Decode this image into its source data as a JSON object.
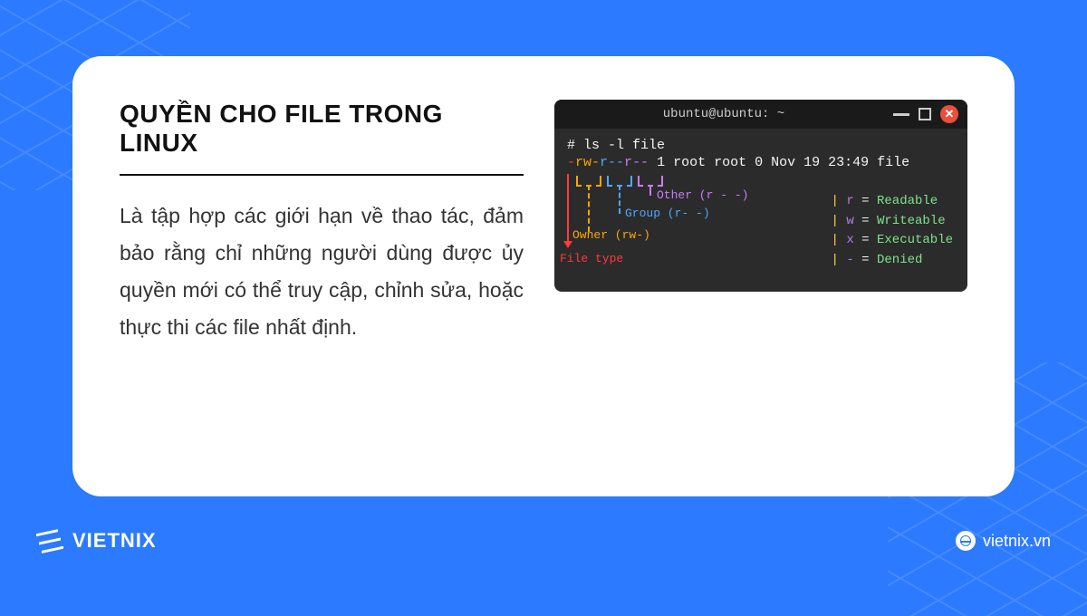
{
  "title": "QUYỀN CHO FILE TRONG LINUX",
  "description": "Là tập hợp các giới hạn về thao tác, đảm bảo rằng chỉ những người dùng được ủy quyền mới có thể truy cập, chỉnh sửa, hoặc thực thi các file nhất định.",
  "terminal": {
    "window_title": "ubuntu@ubuntu: ~",
    "command": "# ls -l file",
    "perm_filetype": "-",
    "perm_owner": "rw-",
    "perm_group": "r--",
    "perm_other": "r--",
    "rest": " 1 root root 0 Nov 19 23:49 file",
    "labels": {
      "other": "Other (r - -)",
      "group": "Group (r- -)",
      "owner": "Owner (rw-)",
      "filetype": "File type"
    },
    "legend": [
      {
        "key": "r",
        "val": "Readable"
      },
      {
        "key": "w",
        "val": "Writeable"
      },
      {
        "key": "x",
        "val": "Executable"
      },
      {
        "key": "-",
        "val": "Denied"
      }
    ]
  },
  "brand": "VIETNIX",
  "site": "vietnix.vn"
}
